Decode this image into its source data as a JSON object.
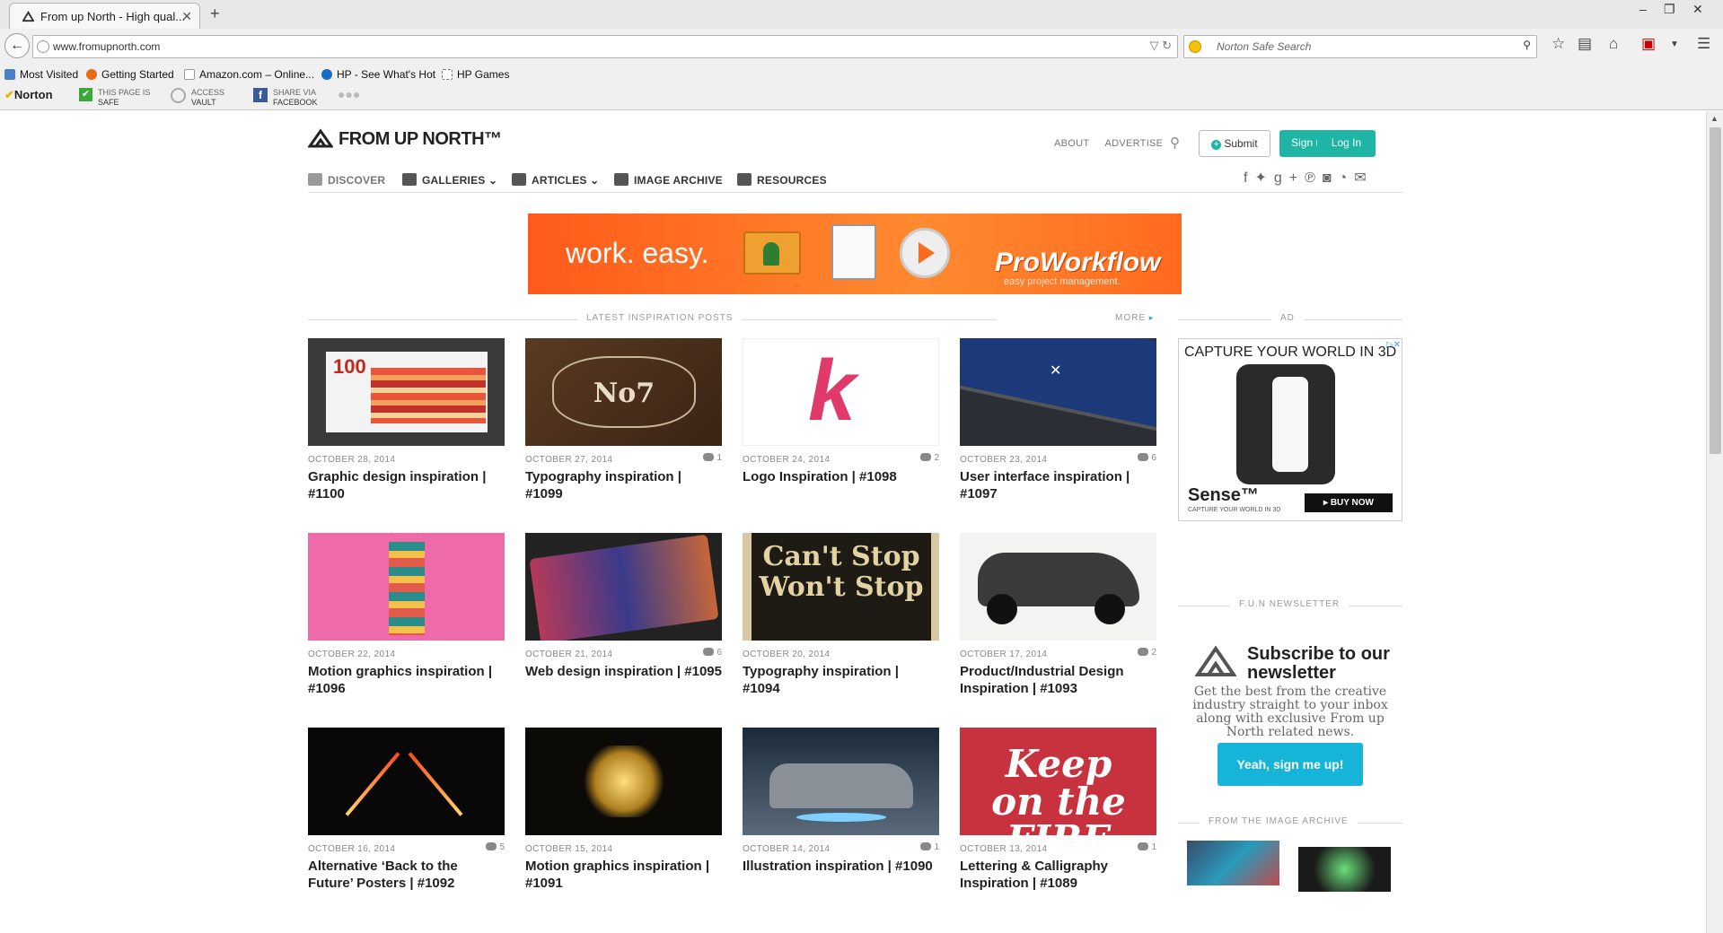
{
  "browser": {
    "tab_title": "From up North - High qual...",
    "url": "www.fromupnorth.com",
    "search_placeholder": "Norton Safe Search",
    "bookmarks": [
      "Most Visited",
      "Getting Started",
      "Amazon.com – Online...",
      "HP - See What's Hot",
      "HP Games"
    ],
    "norton": {
      "brand": "Norton",
      "safe_line1": "THIS PAGE IS",
      "safe_line2": "SAFE",
      "vault_line1": "ACCESS",
      "vault_line2": "VAULT",
      "fb_line1": "SHARE VIA",
      "fb_line2": "FACEBOOK"
    }
  },
  "site": {
    "logo": "FROM UP NORTH™",
    "top_links": [
      "ABOUT",
      "ADVERTISE"
    ],
    "submit_label": "Submit",
    "signup_label": "Sign up",
    "login_label": "Log In",
    "nav": [
      "DISCOVER",
      "GALLERIES",
      "ARTICLES",
      "IMAGE ARCHIVE",
      "RESOURCES"
    ],
    "accent": "#1fb5a5"
  },
  "banner": {
    "tagline": "work. easy.",
    "brand": "ProWorkflow",
    "brand_sub": "easy project management."
  },
  "latest": {
    "heading": "LATEST INSPIRATION POSTS",
    "more": "MORE"
  },
  "posts": [
    {
      "date": "OCTOBER 28, 2014",
      "comments": "",
      "title": "Graphic design inspiration | #1100"
    },
    {
      "date": "OCTOBER 27, 2014",
      "comments": "1",
      "title": "Typography inspiration | #1099"
    },
    {
      "date": "OCTOBER 24, 2014",
      "comments": "2",
      "title": "Logo Inspiration | #1098"
    },
    {
      "date": "OCTOBER 23, 2014",
      "comments": "6",
      "title": "User interface inspiration | #1097"
    },
    {
      "date": "OCTOBER 22, 2014",
      "comments": "",
      "title": "Motion graphics inspiration | #1096"
    },
    {
      "date": "OCTOBER 21, 2014",
      "comments": "6",
      "title": "Web design inspiration | #1095"
    },
    {
      "date": "OCTOBER 20, 2014",
      "comments": "",
      "title": "Typography inspiration | #1094"
    },
    {
      "date": "OCTOBER 17, 2014",
      "comments": "2",
      "title": "Product/Industrial Design Inspiration | #1093"
    },
    {
      "date": "OCTOBER 16, 2014",
      "comments": "5",
      "title": "Alternative ‘Back to the Future’ Posters | #1092"
    },
    {
      "date": "OCTOBER 15, 2014",
      "comments": "",
      "title": "Motion graphics inspiration | #1091"
    },
    {
      "date": "OCTOBER 14, 2014",
      "comments": "1",
      "title": "Illustration inspiration | #1090"
    },
    {
      "date": "OCTOBER 13, 2014",
      "comments": "1",
      "title": "Lettering & Calligraphy Inspiration | #1089"
    }
  ],
  "thumb_text": {
    "t1_num": "100",
    "t2_word": "No7",
    "t3_letter": "k",
    "t7_text": "Can't Stop Won't Stop",
    "t12_text": "Keep on the FIRE"
  },
  "sidebar": {
    "ad_heading": "AD",
    "ad_title": "CAPTURE YOUR WORLD IN 3D",
    "ad_brand": "Sense™",
    "ad_brand_sub": "CAPTURE YOUR WORLD IN 3D",
    "ad_buy": "▸ BUY NOW",
    "newsletter_heading": "F.U.N NEWSLETTER",
    "newsletter_title": "Subscribe to our newsletter",
    "newsletter_body": "Get the best from the creative industry straight to your inbox along with exclusive From up North related news.",
    "newsletter_button": "Yeah, sign me up!",
    "archive_heading": "FROM THE IMAGE ARCHIVE"
  }
}
